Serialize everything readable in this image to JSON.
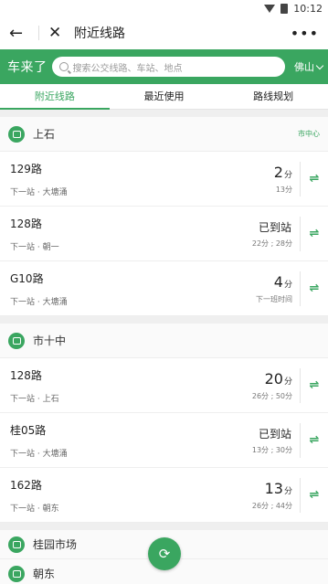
{
  "status": {
    "time": "10:12"
  },
  "nav": {
    "title": "附近线路"
  },
  "search": {
    "brand": "车来了",
    "placeholder": "搜索公交线路、车站、地点",
    "city": "佛山"
  },
  "tabs": [
    {
      "label": "附近线路"
    },
    {
      "label": "最近使用"
    },
    {
      "label": "路线规划"
    }
  ],
  "stops": [
    {
      "name": "上石",
      "tag": "市中心",
      "routes": [
        {
          "name": "129路",
          "next": "下一站 · 大塘涌",
          "eta": "2",
          "unit": "分",
          "sub": "13分"
        },
        {
          "name": "128路",
          "next": "下一站 · 朝一",
          "eta": "已到站",
          "unit": "",
          "sub": "22分 ; 28分"
        },
        {
          "name": "G10路",
          "next": "下一站 · 大塘涌",
          "eta": "4",
          "unit": "分",
          "sub": "下一班时间"
        }
      ]
    },
    {
      "name": "市十中",
      "tag": "",
      "routes": [
        {
          "name": "128路",
          "next": "下一站 · 上石",
          "eta": "20",
          "unit": "分",
          "sub": "26分 ; 50分"
        },
        {
          "name": "桂05路",
          "next": "下一站 · 大塘涌",
          "eta": "已到站",
          "unit": "",
          "sub": "13分 ; 30分"
        },
        {
          "name": "162路",
          "next": "下一站 · 朝东",
          "eta": "13",
          "unit": "分",
          "sub": "26分 ; 44分"
        }
      ]
    }
  ],
  "more_stops": [
    {
      "name": "桂园市场"
    },
    {
      "name": "朝东"
    }
  ],
  "colors": {
    "accent": "#3aa660"
  }
}
